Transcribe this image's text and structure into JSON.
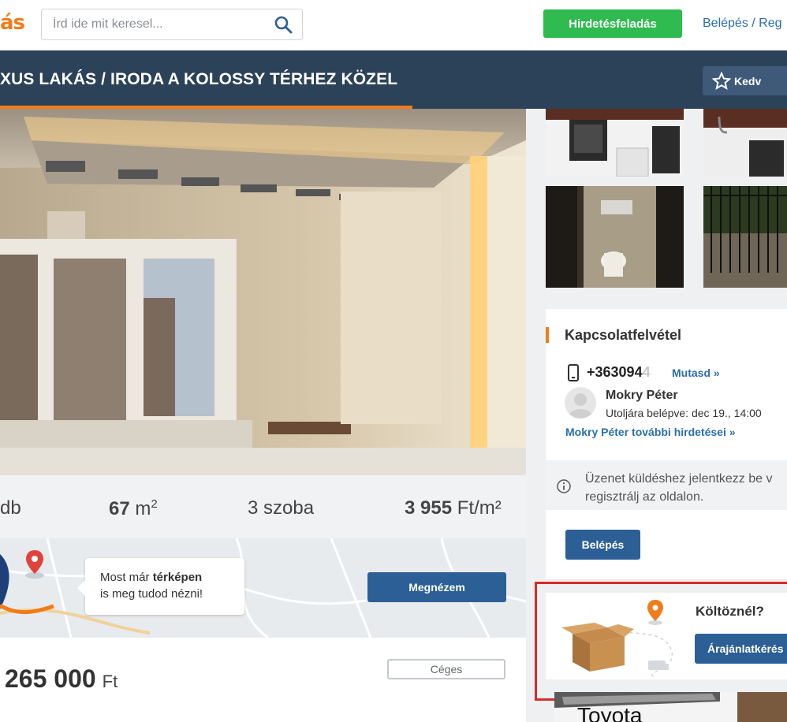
{
  "header": {
    "logo_text": "ás",
    "search_placeholder": "Írd ide mit keresel...",
    "post_button": "Hirdetésfeladás",
    "login_link": "Belépés / Reg"
  },
  "listing": {
    "title": "XUS LAKÁS / IRODA A KOLOSSY TÉRHEZ KÖZEL",
    "favorite_button": "Kedv"
  },
  "stats": {
    "room_fragment": "db",
    "area_value": "67",
    "area_unit": "m",
    "area_sup": "2",
    "rooms": "3 szoba",
    "price_per_sqm_value": "3 955",
    "price_per_sqm_unit": "Ft/m²"
  },
  "map_promo": {
    "line1_prefix": "Most már ",
    "line1_bold": "térképen",
    "line2": "is meg tudod nézni!",
    "button": "Megnézem"
  },
  "price": {
    "amount": "265 000",
    "currency": "Ft",
    "badge": "Céges"
  },
  "contact": {
    "title": "Kapcsolatfelvétel",
    "phone_visible": "+363094",
    "phone_masked": "4",
    "show_link": "Mutasd »",
    "seller_name": "Mokry Péter",
    "last_login": "Utoljára belépve: dec 19., 14:00",
    "more_ads": "Mokry Péter további hirdetései »",
    "notice_line1": "Üzenet küldéshez jelentkezz be v",
    "notice_line2": "regisztrálj az oldalon.",
    "login_button": "Belépés"
  },
  "moving": {
    "title": "Költöznél?",
    "button": "Árajánlatkérés"
  },
  "ad": {
    "text": "Toyota"
  },
  "colors": {
    "navy": "#2c4259",
    "accent_orange": "#f07c1a",
    "green": "#2fbb4f",
    "blue_button": "#2c5f96",
    "link_blue": "#2a6fb0",
    "highlight_red": "#d62b2b"
  }
}
